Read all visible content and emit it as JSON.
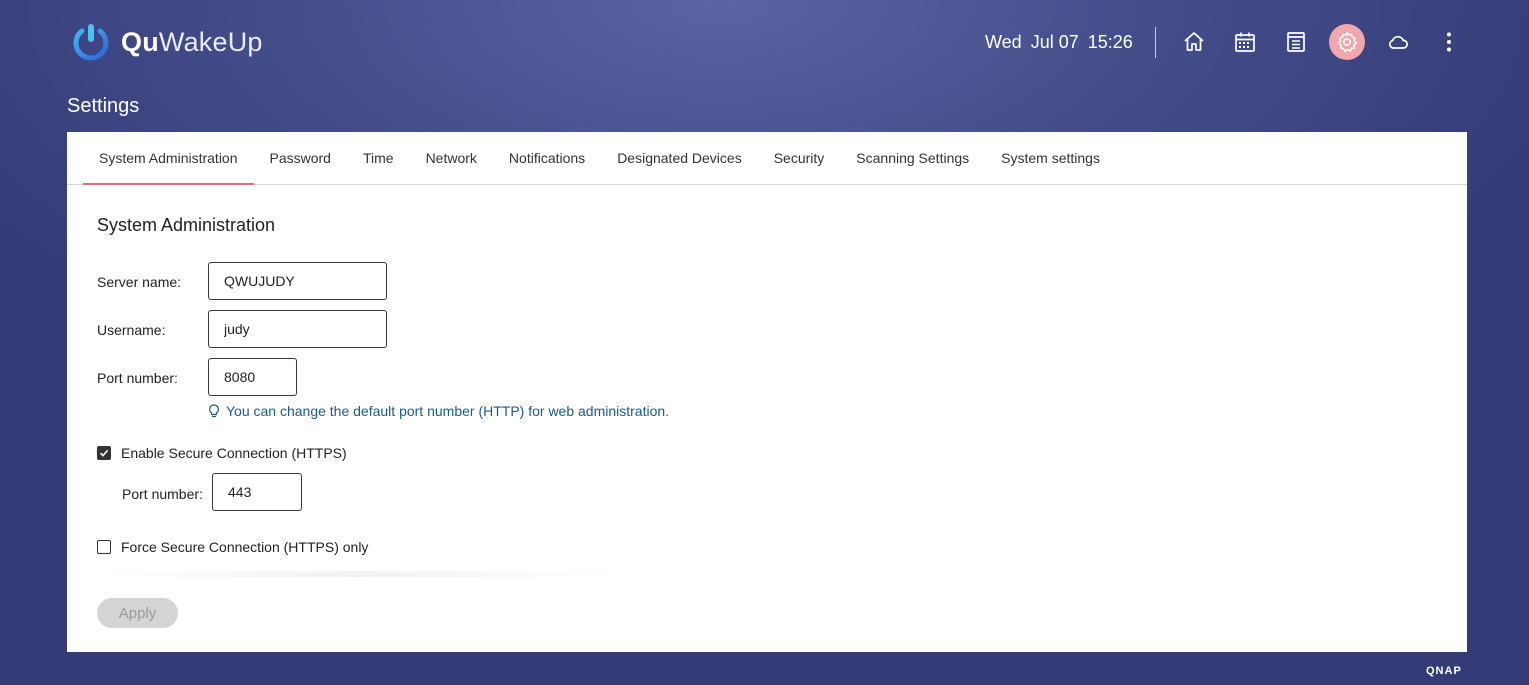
{
  "header": {
    "app_name_part1": "Qu",
    "app_name_part2": "WakeUp",
    "day": "Wed",
    "date": "Jul 07",
    "time": "15:26",
    "icons": [
      "home-icon",
      "calendar-icon",
      "log-icon",
      "settings-icon",
      "cloud-icon",
      "more-icon"
    ],
    "active_color": "#f3a7ad"
  },
  "page_title": "Settings",
  "tabs": [
    "System Administration",
    "Password",
    "Time",
    "Network",
    "Notifications",
    "Designated Devices",
    "Security",
    "Scanning Settings",
    "System settings"
  ],
  "form": {
    "section_title": "System Administration",
    "server_name_label": "Server name:",
    "server_name_value": "QWUJUDY",
    "username_label": "Username:",
    "username_value": "judy",
    "port_label": "Port number:",
    "port_value": "8080",
    "port_hint": "You can change the default port number (HTTP) for web administration.",
    "https_label": "Enable Secure Connection (HTTPS)",
    "https_checked": true,
    "https_port_label": "Port number:",
    "https_port_value": "443",
    "force_https_label": "Force Secure Connection (HTTPS) only",
    "force_https_checked": false,
    "apply_label": "Apply"
  },
  "footer": {
    "brand": "QNAP"
  },
  "colors": {
    "accent": "#e46b88",
    "hint": "#1f5a86"
  }
}
